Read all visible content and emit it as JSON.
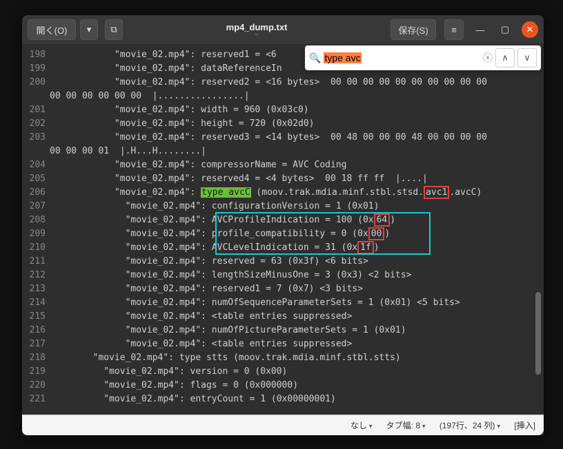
{
  "titlebar": {
    "open": "開く(O)",
    "save": "保存(S)",
    "title": "mp4_dump.txt",
    "subtitle": "~"
  },
  "search": {
    "value": "type avc"
  },
  "gutter_start": 198,
  "lines": [
    {
      "indent": 6,
      "t": "\"movie_02.mp4\": reserved1 = <6 "
    },
    {
      "indent": 6,
      "t": "\"movie_02.mp4\": dataReferenceIn"
    },
    {
      "indent": 6,
      "t": "\"movie_02.mp4\": reserved2 = <16 bytes>  00 00 00 00 00 00 00 00 00 00"
    },
    {
      "wrap": true,
      "t": "00 00 00 00 00 00  |................|"
    },
    {
      "indent": 6,
      "t": "\"movie_02.mp4\": width = 960 (0x03c0)"
    },
    {
      "indent": 6,
      "t": "\"movie_02.mp4\": height = 720 (0x02d0)"
    },
    {
      "indent": 6,
      "t": "\"movie_02.mp4\": reserved3 = <14 bytes>  00 48 00 00 00 48 00 00 00 00"
    },
    {
      "wrap": true,
      "t": "00 00 00 01  |.H...H........|"
    },
    {
      "indent": 6,
      "t": "\"movie_02.mp4\": compressorName = AVC Coding"
    },
    {
      "indent": 6,
      "t": "\"movie_02.mp4\": reserved4 = <4 bytes>  00 18 ff ff  |....|"
    },
    {
      "indent": 6,
      "special": "avcc"
    },
    {
      "indent": 7,
      "t": "\"movie_02.mp4\": configurationVersion = 1 (0x01)"
    },
    {
      "indent": 7,
      "special": "avcprof"
    },
    {
      "indent": 7,
      "special": "profcomp"
    },
    {
      "indent": 7,
      "special": "avclvl"
    },
    {
      "indent": 7,
      "t": "\"movie_02.mp4\": reserved = 63 (0x3f) <6 bits>"
    },
    {
      "indent": 7,
      "t": "\"movie_02.mp4\": lengthSizeMinusOne = 3 (0x3) <2 bits>"
    },
    {
      "indent": 7,
      "t": "\"movie_02.mp4\": reserved1 = 7 (0x7) <3 bits>"
    },
    {
      "indent": 7,
      "t": "\"movie_02.mp4\": numOfSequenceParameterSets = 1 (0x01) <5 bits>"
    },
    {
      "indent": 7,
      "t": "\"movie_02.mp4\": <table entries suppressed>"
    },
    {
      "indent": 7,
      "t": "\"movie_02.mp4\": numOfPictureParameterSets = 1 (0x01)"
    },
    {
      "indent": 7,
      "t": "\"movie_02.mp4\": <table entries suppressed>"
    },
    {
      "indent": 4,
      "t": "\"movie_02.mp4\": type stts (moov.trak.mdia.minf.stbl.stts)"
    },
    {
      "indent": 5,
      "t": "\"movie_02.mp4\": version = 0 (0x00)"
    },
    {
      "indent": 5,
      "t": "\"movie_02.mp4\": flags = 0 (0x000000)"
    },
    {
      "indent": 5,
      "t": "\"movie_02.mp4\": entryCount = 1 (0x00000001)"
    }
  ],
  "special": {
    "avcc_prefix": "\"movie_02.mp4\": ",
    "avcc_type": "type avcC",
    "avcc_mid": " (moov.trak.mdia.minf.stbl.stsd.",
    "avcc_box": "avc1",
    "avcc_suf": ".avcC)",
    "avcprof": "\"movie_02.mp4\": AVCProfileIndication = 100 (0x",
    "avcprof_box": "64",
    "avcprof_close": ")",
    "profcomp": "\"movie_02.mp4\": profile_compatibility = 0 (0x",
    "profcomp_box": "00",
    "profcomp_close": ")",
    "avclvl": "\"movie_02.mp4\": AVCLevelIndication = 31 (0x",
    "avclvl_box": "1f",
    "avclvl_close": ")"
  },
  "status": {
    "lang": "なし",
    "tab": "タブ幅: 8",
    "pos": "(197行、24 列)",
    "mode": "[挿入]"
  }
}
